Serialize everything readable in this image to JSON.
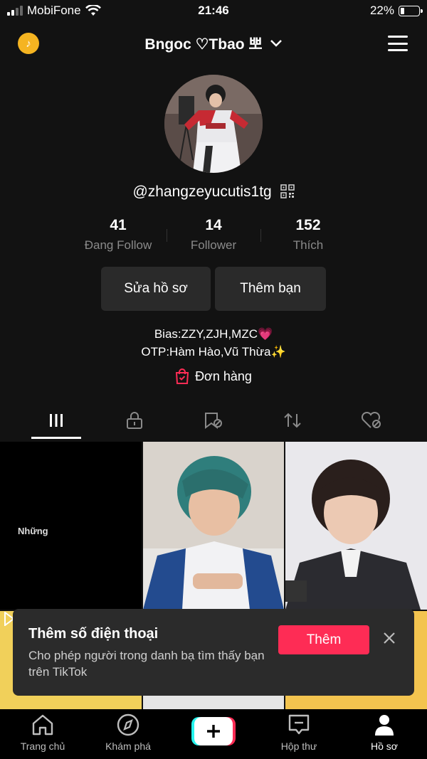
{
  "status_bar": {
    "carrier": "MobiFone",
    "time": "21:46",
    "battery": "22%",
    "battery_level": 0.22
  },
  "header": {
    "title": "Bngoc ♡Tbao 뽀",
    "coin_icon": "tiktok-coin-icon",
    "menu_icon": "hamburger-menu-icon"
  },
  "profile": {
    "username": "@zhangzeyucutis1tg",
    "stats": [
      {
        "value": "41",
        "label": "Đang Follow"
      },
      {
        "value": "14",
        "label": "Follower"
      },
      {
        "value": "152",
        "label": "Thích"
      }
    ],
    "edit_button": "Sửa hồ sơ",
    "add_friend_button": "Thêm bạn",
    "bio_line1": "Bias:ZZY,ZJH,MZC💗",
    "bio_line2": "OTP:Hàm Hào,Vũ Thừa✨",
    "orders_label": "Đơn hàng"
  },
  "tabs": [
    "videos-grid-icon",
    "private-lock-icon",
    "favorites-icon",
    "repost-icon",
    "liked-hidden-icon"
  ],
  "videos": [
    {
      "caption": "Những"
    },
    {
      "caption": ""
    },
    {
      "caption": ""
    }
  ],
  "toast": {
    "title": "Thêm số điện thoại",
    "body": "Cho phép người trong danh bạ tìm thấy bạn trên TikTok",
    "button": "Thêm"
  },
  "bottom_nav": [
    {
      "label": "Trang chủ",
      "icon": "home-icon"
    },
    {
      "label": "Khám phá",
      "icon": "compass-icon"
    },
    {
      "label": "",
      "icon": "create-plus-icon"
    },
    {
      "label": "Hộp thư",
      "icon": "inbox-icon"
    },
    {
      "label": "Hồ sơ",
      "icon": "profile-icon"
    }
  ],
  "colors": {
    "accent": "#fe2c55",
    "background": "#121212",
    "coin": "#f5b421",
    "cyan": "#25f4ee"
  }
}
